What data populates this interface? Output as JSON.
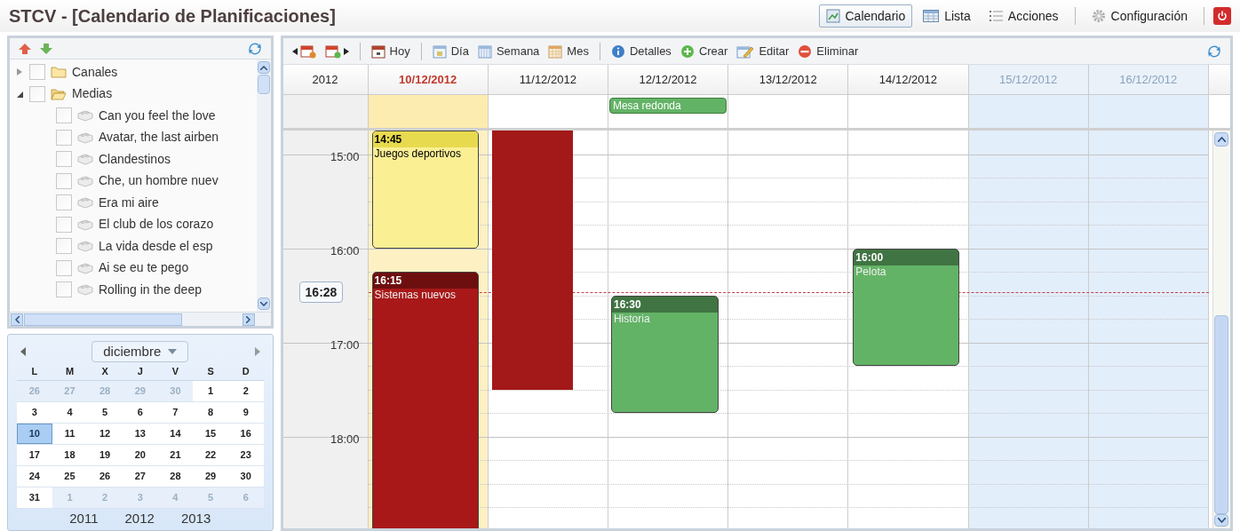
{
  "window": {
    "title": "STCV - [Calendario de Planificaciones]"
  },
  "nav": {
    "groups": [
      [
        {
          "label": "Calendario",
          "selected": true
        },
        {
          "label": "Lista",
          "selected": false
        },
        {
          "label": "Acciones",
          "selected": false
        }
      ],
      [
        {
          "label": "Configuración",
          "selected": false
        }
      ]
    ]
  },
  "tree": {
    "items": [
      {
        "label": "Canales",
        "kind": "folder",
        "checked": false,
        "expanded": false
      },
      {
        "label": "Medias",
        "kind": "folder",
        "checked": false,
        "expanded": true,
        "children": [
          {
            "label": "Can you feel the love",
            "kind": "media",
            "checked": false
          },
          {
            "label": "Avatar, the last airben",
            "kind": "media",
            "checked": false
          },
          {
            "label": "Clandestinos",
            "kind": "media",
            "checked": false
          },
          {
            "label": "Che, un hombre nuev",
            "kind": "media",
            "checked": false
          },
          {
            "label": "Era mi aire",
            "kind": "media",
            "checked": false
          },
          {
            "label": "El club de los corazo",
            "kind": "media",
            "checked": false
          },
          {
            "label": "La vida desde el esp",
            "kind": "media",
            "checked": false
          },
          {
            "label": "Ai se eu te pego",
            "kind": "media",
            "checked": false
          },
          {
            "label": "Rolling in the deep",
            "kind": "media",
            "checked": false
          }
        ]
      }
    ]
  },
  "mini_calendar": {
    "month": "diciembre",
    "weekdays": [
      "L",
      "M",
      "X",
      "J",
      "V",
      "S",
      "D"
    ],
    "weeks": [
      [
        {
          "day": "26",
          "outside": true,
          "selected": false
        },
        {
          "day": "27",
          "outside": true,
          "selected": false
        },
        {
          "day": "28",
          "outside": true,
          "selected": false
        },
        {
          "day": "29",
          "outside": true,
          "selected": false
        },
        {
          "day": "30",
          "outside": true,
          "selected": false
        },
        {
          "day": "1",
          "outside": false,
          "selected": false
        },
        {
          "day": "2",
          "outside": false,
          "selected": false
        }
      ],
      [
        {
          "day": "3",
          "outside": false,
          "selected": false
        },
        {
          "day": "4",
          "outside": false,
          "selected": false
        },
        {
          "day": "5",
          "outside": false,
          "selected": false
        },
        {
          "day": "6",
          "outside": false,
          "selected": false
        },
        {
          "day": "7",
          "outside": false,
          "selected": false
        },
        {
          "day": "8",
          "outside": false,
          "selected": false
        },
        {
          "day": "9",
          "outside": false,
          "selected": false
        }
      ],
      [
        {
          "day": "10",
          "outside": false,
          "selected": true
        },
        {
          "day": "11",
          "outside": false,
          "selected": false
        },
        {
          "day": "12",
          "outside": false,
          "selected": false
        },
        {
          "day": "13",
          "outside": false,
          "selected": false
        },
        {
          "day": "14",
          "outside": false,
          "selected": false
        },
        {
          "day": "15",
          "outside": false,
          "selected": false
        },
        {
          "day": "16",
          "outside": false,
          "selected": false
        }
      ],
      [
        {
          "day": "17",
          "outside": false,
          "selected": false
        },
        {
          "day": "18",
          "outside": false,
          "selected": false
        },
        {
          "day": "19",
          "outside": false,
          "selected": false
        },
        {
          "day": "20",
          "outside": false,
          "selected": false
        },
        {
          "day": "21",
          "outside": false,
          "selected": false
        },
        {
          "day": "22",
          "outside": false,
          "selected": false
        },
        {
          "day": "23",
          "outside": false,
          "selected": false
        }
      ],
      [
        {
          "day": "24",
          "outside": false,
          "selected": false
        },
        {
          "day": "25",
          "outside": false,
          "selected": false
        },
        {
          "day": "26",
          "outside": false,
          "selected": false
        },
        {
          "day": "27",
          "outside": false,
          "selected": false
        },
        {
          "day": "28",
          "outside": false,
          "selected": false
        },
        {
          "day": "29",
          "outside": false,
          "selected": false
        },
        {
          "day": "30",
          "outside": false,
          "selected": false
        }
      ],
      [
        {
          "day": "31",
          "outside": false,
          "selected": false
        },
        {
          "day": "1",
          "outside": true,
          "selected": false
        },
        {
          "day": "2",
          "outside": true,
          "selected": false
        },
        {
          "day": "3",
          "outside": true,
          "selected": false
        },
        {
          "day": "4",
          "outside": true,
          "selected": false
        },
        {
          "day": "5",
          "outside": true,
          "selected": false
        },
        {
          "day": "6",
          "outside": true,
          "selected": false
        }
      ]
    ],
    "years": [
      "2011",
      "2012",
      "2013"
    ]
  },
  "toolbar": {
    "groups": [
      [
        {
          "label": "Hoy"
        }
      ],
      [
        {
          "label": "Día"
        },
        {
          "label": "Semana"
        },
        {
          "label": "Mes"
        }
      ],
      [
        {
          "label": "Detalles"
        },
        {
          "label": "Crear"
        },
        {
          "label": "Editar"
        },
        {
          "label": "Eliminar"
        }
      ]
    ]
  },
  "calendar": {
    "year": "2012",
    "hours": [
      "15:00",
      "16:00",
      "17:00",
      "18:00"
    ],
    "now": "16:28",
    "days": [
      {
        "date": "10/12/2012",
        "kind": "today",
        "events": [
          {
            "time": "14:45",
            "title": "Juegos deportivos",
            "color": "#fbef94"
          },
          {
            "time": "16:15",
            "title": "Sistemas nuevos",
            "color": "#a81818"
          }
        ]
      },
      {
        "date": "11/12/2012",
        "kind": "weekday",
        "events": [
          {
            "color": "#a31818"
          }
        ]
      },
      {
        "date": "12/12/2012",
        "kind": "weekday",
        "all_day": [
          {
            "title": "Mesa redonda",
            "color": "#63b366"
          }
        ],
        "events": [
          {
            "time": "16:30",
            "title": "Historia",
            "color": "#63b366"
          }
        ]
      },
      {
        "date": "13/12/2012",
        "kind": "weekday"
      },
      {
        "date": "14/12/2012",
        "kind": "weekday",
        "events": [
          {
            "time": "16:00",
            "title": "Pelota",
            "color": "#63b366"
          }
        ]
      },
      {
        "date": "15/12/2012",
        "kind": "weekend"
      },
      {
        "date": "16/12/2012",
        "kind": "weekend"
      }
    ]
  }
}
